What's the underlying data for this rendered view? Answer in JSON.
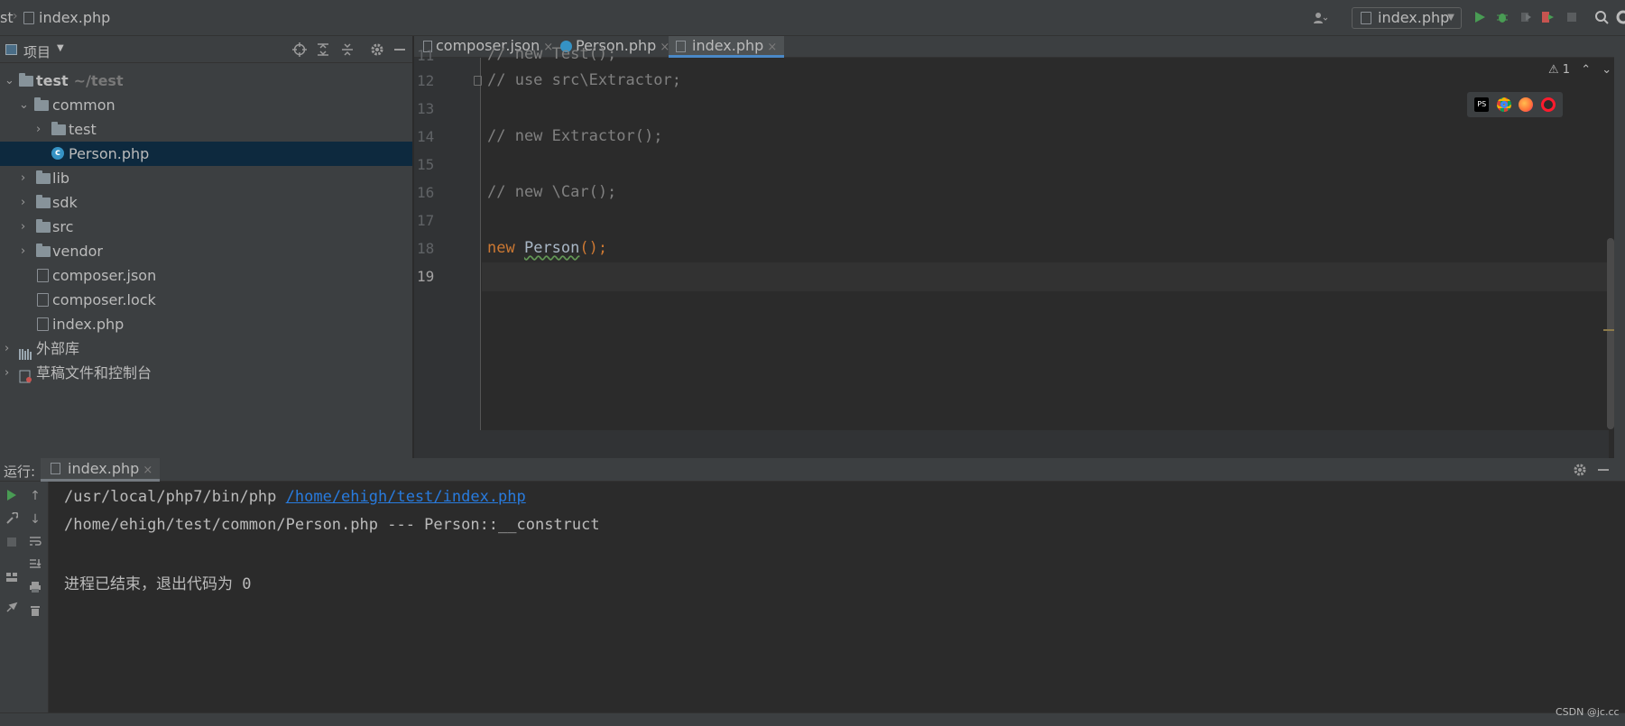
{
  "breadcrumb": {
    "project": "st",
    "file": "index.php"
  },
  "toolbar": {
    "run_config": "index.php"
  },
  "colors": {
    "accent": "#4a88c7",
    "run": "#499c54",
    "selection": "#0d293e",
    "keyword": "#cc7832",
    "comment": "#808080",
    "link": "#287bde"
  },
  "project": {
    "title": "项目",
    "tree": [
      {
        "label": "test",
        "hint": "~/test",
        "kind": "folder",
        "expanded": true
      },
      {
        "label": "common",
        "kind": "folder",
        "expanded": true
      },
      {
        "label": "test",
        "kind": "folder",
        "expanded": false
      },
      {
        "label": "Person.php",
        "kind": "class",
        "selected": true
      },
      {
        "label": "lib",
        "kind": "folder"
      },
      {
        "label": "sdk",
        "kind": "folder"
      },
      {
        "label": "src",
        "kind": "folder"
      },
      {
        "label": "vendor",
        "kind": "folder"
      },
      {
        "label": "composer.json",
        "kind": "file"
      },
      {
        "label": "composer.lock",
        "kind": "file"
      },
      {
        "label": "index.php",
        "kind": "php"
      },
      {
        "label": "外部库",
        "kind": "library"
      },
      {
        "label": "草稿文件和控制台",
        "kind": "scratch"
      }
    ]
  },
  "tabs": [
    {
      "label": "composer.json",
      "icon": "json-file-icon"
    },
    {
      "label": "Person.php",
      "icon": "class-icon"
    },
    {
      "label": "index.php",
      "icon": "php-file-icon",
      "active": true
    }
  ],
  "editor": {
    "warning_count": "1",
    "lines": [
      {
        "n": "11",
        "text": "// new Test();"
      },
      {
        "n": "12",
        "text": "// use src\\Extractor;"
      },
      {
        "n": "13",
        "text": ""
      },
      {
        "n": "14",
        "text": "// new Extractor();"
      },
      {
        "n": "15",
        "text": ""
      },
      {
        "n": "16",
        "text": "// new \\Car();"
      },
      {
        "n": "17",
        "text": ""
      },
      {
        "n": "18",
        "kw": "new",
        "cls": "Person",
        "rest": "();"
      },
      {
        "n": "19",
        "text": ""
      }
    ]
  },
  "run": {
    "label": "运行:",
    "tab": "index.php",
    "console": {
      "cmd": "/usr/local/php7/bin/php ",
      "cmd_link": "/home/ehigh/test/index.php",
      "out1": "/home/ehigh/test/common/Person.php --- Person::__construct",
      "out2": "进程已结束，退出代码为 0"
    }
  },
  "watermark": "CSDN @jc.cc"
}
